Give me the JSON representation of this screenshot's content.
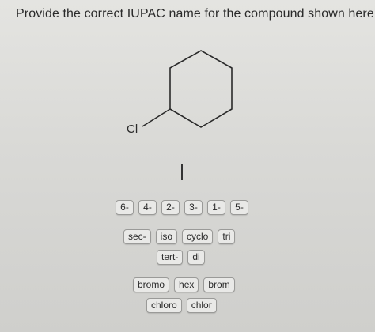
{
  "question": "Provide the correct IUPAC name for the compound shown here.",
  "molecule": {
    "substituent_label": "Cl"
  },
  "tiles": {
    "locants": [
      "6-",
      "4-",
      "2-",
      "3-",
      "1-",
      "5-"
    ],
    "prefixes_row1": [
      "sec-",
      "iso",
      "cyclo",
      "tri"
    ],
    "prefixes_row2": [
      "tert-",
      "di"
    ],
    "roots_row1": [
      "bromo",
      "hex",
      "brom"
    ],
    "roots_row2": [
      "chloro",
      "chlor"
    ]
  }
}
